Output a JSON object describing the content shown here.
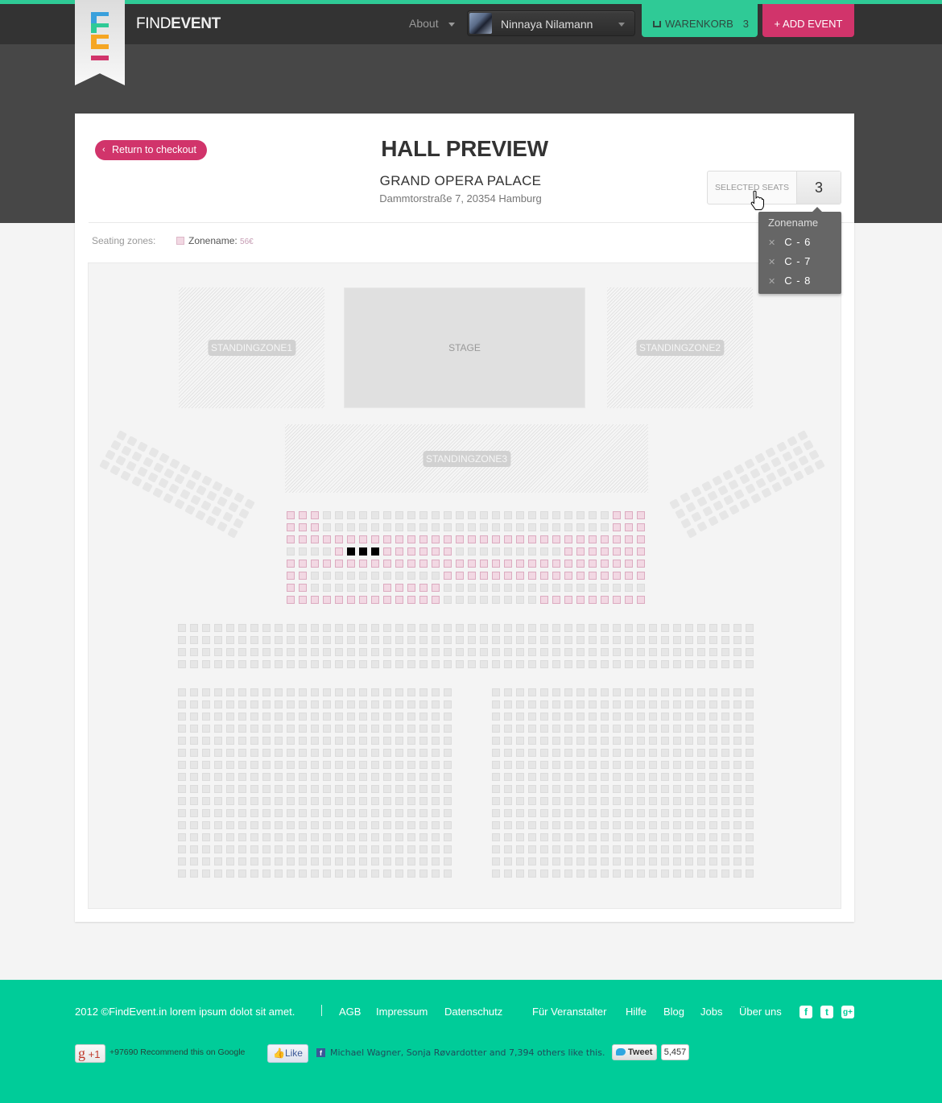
{
  "header": {
    "brand_light": "FIND",
    "brand_bold": "EVENT",
    "about_label": "About",
    "user_name": "Ninnaya Nilamann",
    "cart_label": "WARENKORB",
    "cart_count": "3",
    "add_event_label": "+ ADD EVENT",
    "colors": {
      "accent_green": "#2fca96",
      "accent_pink": "#d1346b",
      "logo": [
        "#3aa0dc",
        "#2fca96",
        "#f5a623",
        "#d1346b"
      ]
    }
  },
  "page": {
    "return_label": "Return to checkout",
    "title": "HALL PREVIEW",
    "venue_name": "GRAND OPERA PALACE",
    "venue_address": "Dammtorstraße 7, 20354 Hamburg",
    "selected_seats_label": "SELECTED SEATS",
    "selected_seats_count": "3",
    "seating_zones_label": "Seating zones:",
    "zone_legend": {
      "name": "Zonename:",
      "price": "56€",
      "color": "#f2d8e3"
    }
  },
  "tooltip": {
    "title": "Zonename",
    "items": [
      {
        "label": "C - 6"
      },
      {
        "label": "C - 7"
      },
      {
        "label": "C - 8"
      }
    ]
  },
  "hall": {
    "standing_zones": [
      "STANDINGZONE1",
      "STANDINGZONE2",
      "STANDINGZONE3"
    ],
    "stage_label": "STAGE",
    "pink_zone": {
      "columns": 30,
      "rows": [
        "PPPGGGGGGGGGGGGGGGGGGGGGGGGPPP",
        "PPPGGGGGGGGGGGGGGGGGGGGGGGGPPP",
        "PPPPPPPPPPPPPPPPPPPPPPPPPPPPPP",
        "GGGGPBBBPPPPPPGGGGGGGGGPPPPPPP",
        "PPPPPPPPPPPPPPPPPPPPPPPPPPPPPP",
        "PPGGGGGGGGGGGPPPPPPPPPPPPPPPPP",
        "PPGGGGGGPPPPPGGGGGGGGGGGGGGGGG",
        "PPPPPPPPPPPPPGGGGGGGGPPPPPPPPP"
      ],
      "legend": {
        "P": "available-zone",
        "G": "unavailable",
        "B": "selected"
      }
    },
    "middle_block": {
      "rows": 4,
      "columns": 48
    },
    "lower_left_block": {
      "rows": 16,
      "columns": 23
    },
    "lower_right_block": {
      "rows": 16,
      "columns": 22
    },
    "side_blocks": {
      "rows": 4,
      "columns": 13
    }
  },
  "footer": {
    "copyright": "2012 ©FindEvent.in lorem ipsum dolot sit amet.",
    "links": [
      "AGB",
      "Impressum",
      "Datenschutz",
      "Für Veranstalter",
      "Hilfe",
      "Blog",
      "Jobs",
      "Über uns"
    ],
    "social_icons": [
      "facebook-icon",
      "twitter-icon",
      "google-plus-icon"
    ],
    "gplus_label": "+1",
    "gplus_text": "+97690 Recommend this on Google",
    "like_label": "Like",
    "fb_text": "Michael Wagner, Sonja Røvardotter and 7,394 others like this.",
    "tweet_label": "Tweet",
    "tweet_count": "5,457"
  }
}
